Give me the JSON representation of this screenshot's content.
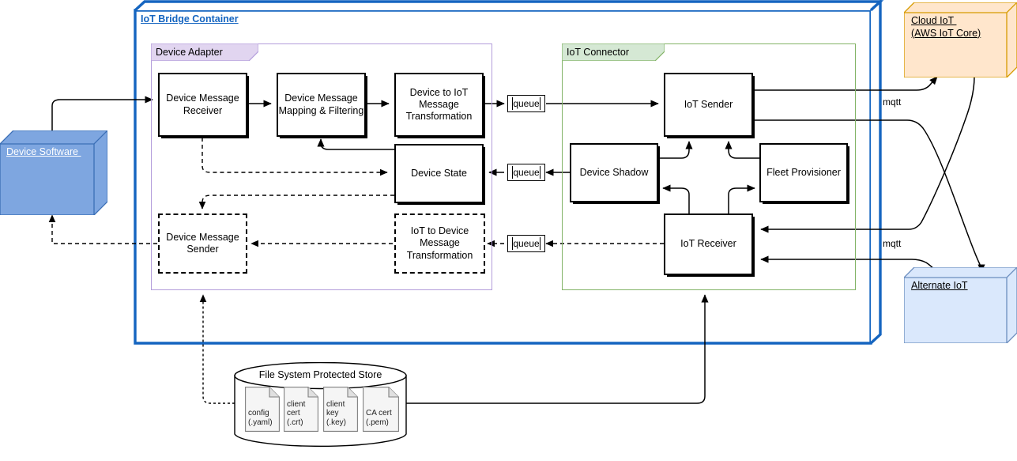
{
  "diagram": {
    "title": "IoT Bridge Container",
    "type": "architecture-block-diagram"
  },
  "container": {
    "label": "IoT Bridge Container",
    "color": "#1565C0"
  },
  "groups": [
    {
      "id": "device-adapter",
      "label": "Device Adapter",
      "border": "#B39DDB",
      "fill": "#E1D5F0"
    },
    {
      "id": "iot-connector",
      "label": "IoT Connector",
      "border": "#82B366",
      "fill": "#D5E8D4"
    }
  ],
  "device_adapter_nodes": [
    {
      "id": "device-message-receiver",
      "label": "Device Message\nReceiver",
      "style": "solid"
    },
    {
      "id": "device-message-mapping-filtering",
      "label": "Device Message\nMapping & Filtering",
      "style": "solid"
    },
    {
      "id": "device-to-iot-message-transformation",
      "label": "Device to IoT\nMessage\nTransformation",
      "style": "solid"
    },
    {
      "id": "device-state",
      "label": "Device State",
      "style": "solid"
    },
    {
      "id": "device-message-sender",
      "label": "Device Message\nSender",
      "style": "dashed"
    },
    {
      "id": "iot-to-device-message-transformation",
      "label": "IoT to Device\nMessage\nTransformation",
      "style": "dashed"
    }
  ],
  "iot_connector_nodes": [
    {
      "id": "iot-sender",
      "label": "IoT Sender",
      "style": "solid"
    },
    {
      "id": "device-shadow",
      "label": "Device Shadow",
      "style": "solid"
    },
    {
      "id": "fleet-provisioner",
      "label": "Fleet Provisioner",
      "style": "solid"
    },
    {
      "id": "iot-receiver",
      "label": "IoT Receiver",
      "style": "solid"
    }
  ],
  "queues": [
    {
      "id": "queue-device-to-iot",
      "label": "queue"
    },
    {
      "id": "queue-shadow-to-state",
      "label": "queue"
    },
    {
      "id": "queue-receiver-to-transform",
      "label": "queue"
    }
  ],
  "external_nodes": [
    {
      "id": "device-software",
      "label": "Device Software ",
      "fill": "#7EA6E0",
      "stroke": "#3B6FB6",
      "text": "#ffffff"
    },
    {
      "id": "cloud-iot",
      "label": "Cloud IoT \n(AWS IoT Core)",
      "fill": "#FFE6CC",
      "stroke": "#D79B00",
      "text": "#000000"
    },
    {
      "id": "alternate-iot",
      "label": "Alternate IoT",
      "fill": "#DAE8FC",
      "stroke": "#6C8EBF",
      "text": "#000000"
    }
  ],
  "datastore": {
    "id": "file-system-protected-store",
    "label": "File System Protected Store",
    "files": [
      {
        "id": "config-yaml",
        "line1": "config",
        "line2": "(.yaml)"
      },
      {
        "id": "client-cert-crt",
        "line1": "client",
        "line2": "cert",
        "line3": "(.crt)"
      },
      {
        "id": "client-key-key",
        "line1": "client",
        "line2": "key",
        "line3": "(.key)"
      },
      {
        "id": "ca-cert-pem",
        "line1": "CA cert",
        "line2": "(.pem)"
      }
    ]
  },
  "edge_labels": [
    {
      "id": "mqtt-top",
      "label": "mqtt"
    },
    {
      "id": "mqtt-bottom",
      "label": "mqtt"
    }
  ]
}
